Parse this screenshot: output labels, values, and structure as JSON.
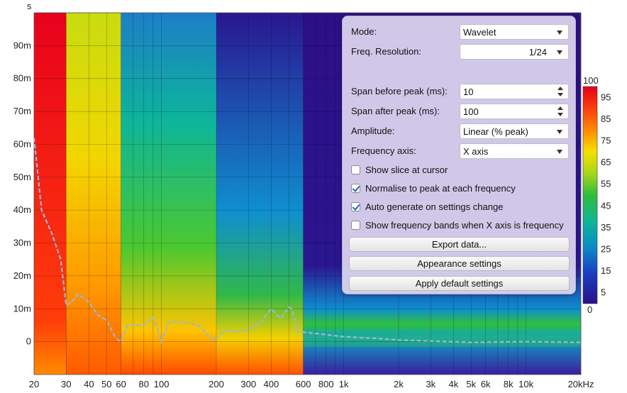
{
  "axes": {
    "y_unit": "s",
    "y_ticks": [
      "90m",
      "80m",
      "70m",
      "60m",
      "50m",
      "40m",
      "30m",
      "20m",
      "10m",
      "0"
    ],
    "x_ticks": [
      "20",
      "30",
      "40",
      "50",
      "60",
      "80",
      "100",
      "200",
      "300",
      "400",
      "600",
      "800",
      "1k",
      "2k",
      "3k",
      "4k",
      "5k",
      "6k",
      "8k",
      "10k",
      "20kHz"
    ]
  },
  "color_scale": {
    "top": "100",
    "bottom": "0",
    "labels": [
      "95",
      "85",
      "75",
      "65",
      "55",
      "45",
      "35",
      "25",
      "15",
      "5"
    ]
  },
  "settings_panel": {
    "mode": {
      "label": "Mode:",
      "value": "Wavelet"
    },
    "freq_resolution": {
      "label": "Freq. Resolution:",
      "value": "1/24"
    },
    "span_before": {
      "label": "Span before peak (ms):",
      "value": "10"
    },
    "span_after": {
      "label": "Span after peak (ms):",
      "value": "100"
    },
    "amplitude": {
      "label": "Amplitude:",
      "value": "Linear (% peak)"
    },
    "frequency_axis": {
      "label": "Frequency axis:",
      "value": "X axis"
    },
    "show_slice": {
      "label": "Show slice at cursor",
      "checked": false
    },
    "normalise": {
      "label": "Normalise to peak at each frequency",
      "checked": true
    },
    "auto_generate": {
      "label": "Auto generate on settings change",
      "checked": true
    },
    "show_bands": {
      "label": "Show frequency bands when X axis is frequency",
      "checked": false
    },
    "export_button": "Export data...",
    "appearance_button": "Appearance settings",
    "defaults_button": "Apply default settings"
  },
  "chart_data": {
    "type": "heatmap",
    "title": "",
    "xlabel": "",
    "ylabel": "s",
    "x_scale": "log",
    "xlim": [
      20,
      20000
    ],
    "ylim": [
      -0.01,
      0.1
    ],
    "zlim": [
      0,
      100
    ],
    "peak_line": {
      "style": "dashed",
      "x": [
        20,
        22,
        25,
        28,
        30,
        32,
        35,
        40,
        45,
        50,
        55,
        58,
        60,
        65,
        70,
        80,
        90,
        95,
        100,
        110,
        130,
        160,
        190,
        200,
        220,
        250,
        300,
        350,
        400,
        450,
        500,
        520,
        560,
        700,
        1000,
        1500,
        2000,
        3000,
        5000,
        10000,
        20000
      ],
      "y": [
        0.062,
        0.04,
        0.033,
        0.025,
        0.011,
        0.012,
        0.0145,
        0.012,
        0.008,
        0.0065,
        0.002,
        0.0005,
        0.0,
        0.005,
        0.005,
        0.005,
        0.0075,
        0.004,
        0.0,
        0.006,
        0.006,
        0.005,
        0.0005,
        0.0005,
        0.0035,
        0.003,
        0.0035,
        0.006,
        0.01,
        0.007,
        0.0105,
        0.0098,
        0.003,
        0.0025,
        0.0015,
        0.001,
        0.0005,
        0.0002,
        -0.0002,
        0.0,
        -0.0002
      ]
    },
    "zones": [
      {
        "x": [
          20,
          30
        ],
        "level": 96
      },
      {
        "x": [
          30,
          60
        ],
        "level": 80
      },
      {
        "x": [
          60,
          200
        ],
        "level": 60
      },
      {
        "x": [
          200,
          600
        ],
        "level": 40
      },
      {
        "x": [
          600,
          20000
        ],
        "level": 10
      }
    ]
  }
}
